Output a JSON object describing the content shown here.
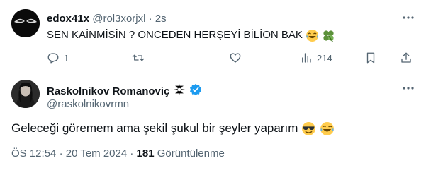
{
  "reply": {
    "display_name": "edox41x",
    "handle": "@rol3xorjxl",
    "separator": "·",
    "time": "2s",
    "text": "SEN KAİNMİSİN ? ONCEDEN HERŞEYİ BİLİON BAK",
    "emojis": [
      "laughing-tears-emoji",
      "four-leaf-clover-emoji"
    ],
    "actions": {
      "replies": "1",
      "reposts": "",
      "likes": "",
      "views": "214"
    }
  },
  "tweet": {
    "display_name": "Raskolnikov Romanoviç",
    "handle": "@raskolnikovrmn",
    "text": "Geleceği göremem ama şekil şukul bir şeyler yaparım",
    "emojis": [
      "sunglasses-emoji",
      "laughing-tears-emoji"
    ],
    "time": "ÖS 12:54",
    "separator": "·",
    "date": "20 Tem 2024",
    "views_count": "181",
    "views_label": "Görüntülenme"
  },
  "colors": {
    "text": "#0f1419",
    "muted": "#536471",
    "verified": "#1d9bf0",
    "divider": "#eff3f4"
  }
}
